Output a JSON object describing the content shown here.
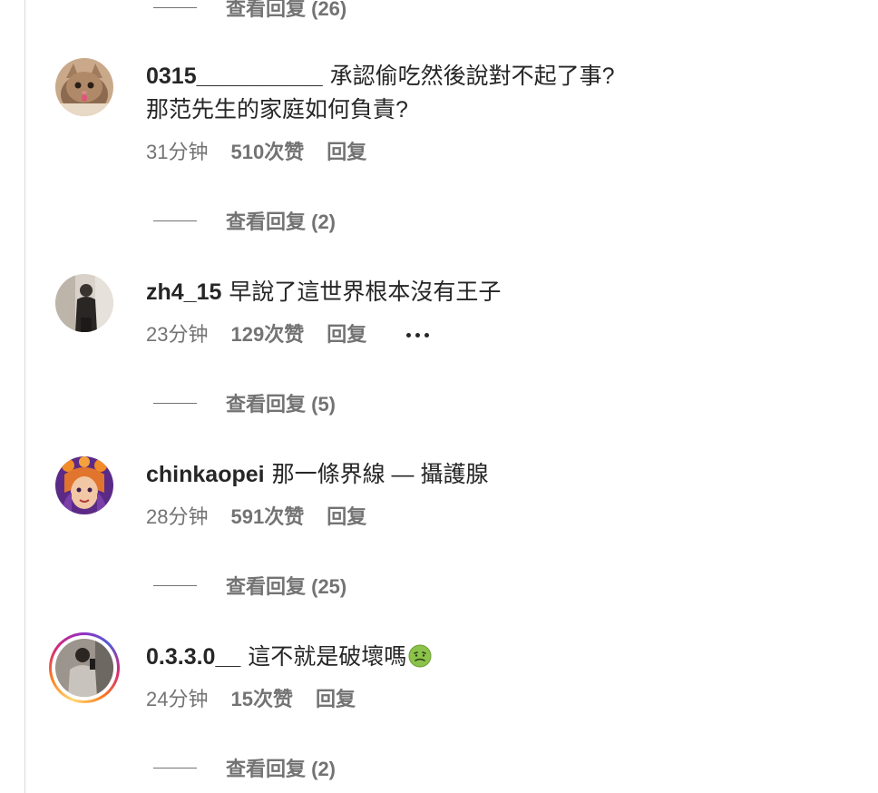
{
  "top_view_replies": "查看回复 (26)",
  "comments": [
    {
      "username": "0315__________",
      "text": "承認偷吃然後說對不起了事?",
      "text_line2": "那范先生的家庭如何負責?",
      "time": "31分钟",
      "likes": "510次赞",
      "reply": "回复",
      "view_replies": "查看回复 (2)"
    },
    {
      "username": "zh4_15",
      "text": "早說了這世界根本沒有王子",
      "time": "23分钟",
      "likes": "129次赞",
      "reply": "回复",
      "more_icon": "more-horizontal-icon",
      "view_replies": "查看回复 (5)"
    },
    {
      "username": "chinkaopei",
      "text": "那一條界線 — 攝護腺",
      "time": "28分钟",
      "likes": "591次赞",
      "reply": "回复",
      "view_replies": "查看回复 (25)"
    },
    {
      "username": "0.3.3.0__",
      "text": "這不就是破壞嗎",
      "emoji_icon": "nauseated-face-emoji",
      "time": "24分钟",
      "likes": "15次赞",
      "reply": "回复",
      "view_replies": "查看回复 (2)"
    }
  ],
  "colors": {
    "text": "#262626",
    "secondary": "#737373",
    "divider": "#dbdbdb",
    "story_ring": [
      "#feda75",
      "#fa7e1e",
      "#d62976",
      "#962fbf",
      "#4f5bd5"
    ]
  }
}
